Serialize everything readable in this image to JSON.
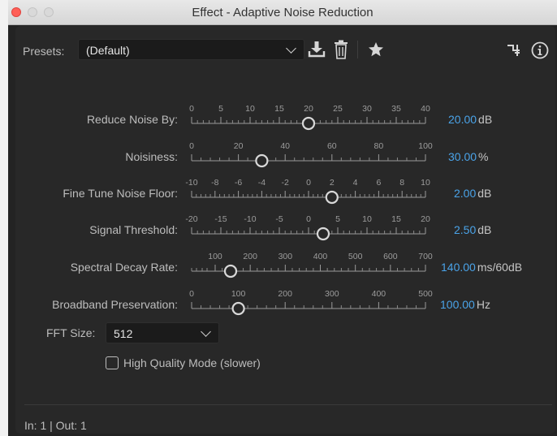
{
  "window": {
    "title": "Effect - Adaptive Noise Reduction"
  },
  "presets": {
    "label": "Presets:",
    "selected": "(Default)"
  },
  "toolbar": {
    "icons": [
      "download-preset-icon",
      "trash-icon",
      "star-icon",
      "routing-icon",
      "info-icon"
    ]
  },
  "params": [
    {
      "label": "Reduce Noise By:",
      "value": "20.00",
      "unit": "dB",
      "ticks": [
        "0",
        "5",
        "10",
        "15",
        "20",
        "25",
        "30",
        "35",
        "40"
      ],
      "fraction": 0.5
    },
    {
      "label": "Noisiness:",
      "value": "30.00",
      "unit": "%",
      "ticks": [
        "0",
        "20",
        "40",
        "60",
        "80",
        "100"
      ],
      "fraction": 0.3
    },
    {
      "label": "Fine Tune Noise Floor:",
      "value": "2.00",
      "unit": "dB",
      "ticks": [
        "-10",
        "-8",
        "-6",
        "-4",
        "-2",
        "0",
        "2",
        "4",
        "6",
        "8",
        "10"
      ],
      "fraction": 0.6
    },
    {
      "label": "Signal Threshold:",
      "value": "2.50",
      "unit": "dB",
      "ticks": [
        "-20",
        "-15",
        "-10",
        "-5",
        "0",
        "5",
        "10",
        "15",
        "20"
      ],
      "fraction": 0.5625
    },
    {
      "label": "Spectral Decay Rate:",
      "value": "140.00",
      "unit": "ms/60dB",
      "ticks": [
        "100",
        "200",
        "300",
        "400",
        "500",
        "600",
        "700"
      ],
      "fraction": 0.0
    },
    {
      "label": "Broadband Preservation:",
      "value": "100.00",
      "unit": "Hz",
      "ticks": [
        "0",
        "100",
        "200",
        "300",
        "400",
        "500"
      ],
      "fraction": 0.2
    }
  ],
  "fft": {
    "label": "FFT Size:",
    "selected": "512"
  },
  "high_quality": {
    "label": "High Quality Mode (slower)",
    "checked": false
  },
  "status": {
    "text": "In: 1 | Out: 1"
  },
  "colors": {
    "accent": "#4aa3e8",
    "background": "#232323"
  }
}
